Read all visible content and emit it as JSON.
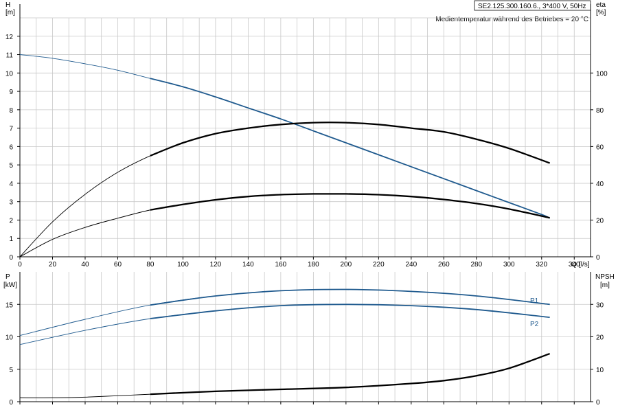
{
  "title_box": "SE2.125.300.160.6., 3*400 V, 50Hz",
  "note": "Medientemperatur während des Betriebes = 20 °C",
  "colors": {
    "blue": "#1f5a8e",
    "grid": "#c8c8c8",
    "black": "#000000"
  },
  "chart_data": [
    {
      "type": "line",
      "name": "pump-curve",
      "ylabel_left": "H",
      "yunit_left": "[m]",
      "ylabel_right": "eta",
      "yunit_right": "[%]",
      "xlabel": "Q",
      "xunit": "[l/s]",
      "xlim": [
        0,
        350
      ],
      "ylim_left": [
        0,
        13
      ],
      "ylim_right": [
        0,
        130
      ],
      "xticks": [
        0,
        20,
        40,
        60,
        80,
        100,
        120,
        140,
        160,
        180,
        200,
        220,
        240,
        260,
        280,
        300,
        320,
        340
      ],
      "yticks_left": [
        0,
        1,
        2,
        3,
        4,
        5,
        6,
        7,
        8,
        9,
        10,
        11,
        12
      ],
      "yticks_right": [
        0,
        20,
        40,
        60,
        80,
        100
      ],
      "series": [
        {
          "axis": "left",
          "color": "#1f5a8e",
          "x": [
            0,
            20,
            40,
            60,
            80,
            100,
            120,
            140,
            160,
            180,
            200,
            220,
            240,
            260,
            280,
            300,
            320,
            325
          ],
          "y": [
            11.0,
            10.8,
            10.5,
            10.15,
            9.7,
            9.25,
            8.7,
            8.1,
            7.5,
            6.85,
            6.2,
            5.55,
            4.9,
            4.25,
            3.6,
            2.95,
            2.3,
            2.1
          ]
        },
        {
          "axis": "right",
          "color": "#000000",
          "x": [
            0,
            20,
            40,
            60,
            80,
            100,
            120,
            140,
            160,
            180,
            200,
            220,
            240,
            260,
            280,
            300,
            325
          ],
          "y": [
            0,
            19,
            34,
            46,
            55,
            62,
            67,
            70,
            72,
            73,
            73,
            72,
            70,
            68,
            64,
            59,
            51
          ]
        },
        {
          "axis": "left",
          "color": "#000000",
          "x": [
            0,
            20,
            40,
            60,
            80,
            100,
            120,
            140,
            160,
            180,
            200,
            220,
            240,
            260,
            280,
            300,
            325
          ],
          "y": [
            0,
            0.95,
            1.6,
            2.1,
            2.55,
            2.85,
            3.1,
            3.28,
            3.38,
            3.42,
            3.42,
            3.38,
            3.28,
            3.12,
            2.9,
            2.6,
            2.12
          ]
        }
      ]
    },
    {
      "type": "line",
      "name": "power-npsh",
      "ylabel_left": "P",
      "yunit_left": "[kW]",
      "ylabel_right": "NPSH",
      "yunit_right": "[m]",
      "xlim": [
        0,
        350
      ],
      "ylim_left": [
        0,
        20
      ],
      "ylim_right": [
        0,
        40
      ],
      "yticks_left": [
        0,
        5,
        10,
        15
      ],
      "yticks_right": [
        0,
        10,
        20,
        30
      ],
      "series": [
        {
          "name": "P1",
          "axis": "left",
          "color": "#1f5a8e",
          "x": [
            0,
            40,
            80,
            120,
            160,
            200,
            240,
            280,
            325
          ],
          "y": [
            10.2,
            12.7,
            14.9,
            16.3,
            17.1,
            17.3,
            17.0,
            16.3,
            15.0
          ]
        },
        {
          "name": "P2",
          "axis": "left",
          "color": "#1f5a8e",
          "x": [
            0,
            40,
            80,
            120,
            160,
            200,
            240,
            280,
            325
          ],
          "y": [
            8.8,
            11.0,
            12.8,
            14.0,
            14.8,
            15.0,
            14.8,
            14.2,
            13.0
          ]
        },
        {
          "axis": "right",
          "color": "#000000",
          "x": [
            0,
            20,
            40,
            80,
            120,
            160,
            200,
            240,
            260,
            280,
            300,
            325
          ],
          "y": [
            1.2,
            1.2,
            1.4,
            2.3,
            3.2,
            3.8,
            4.4,
            5.6,
            6.5,
            8.0,
            10.3,
            14.8
          ]
        }
      ]
    }
  ]
}
